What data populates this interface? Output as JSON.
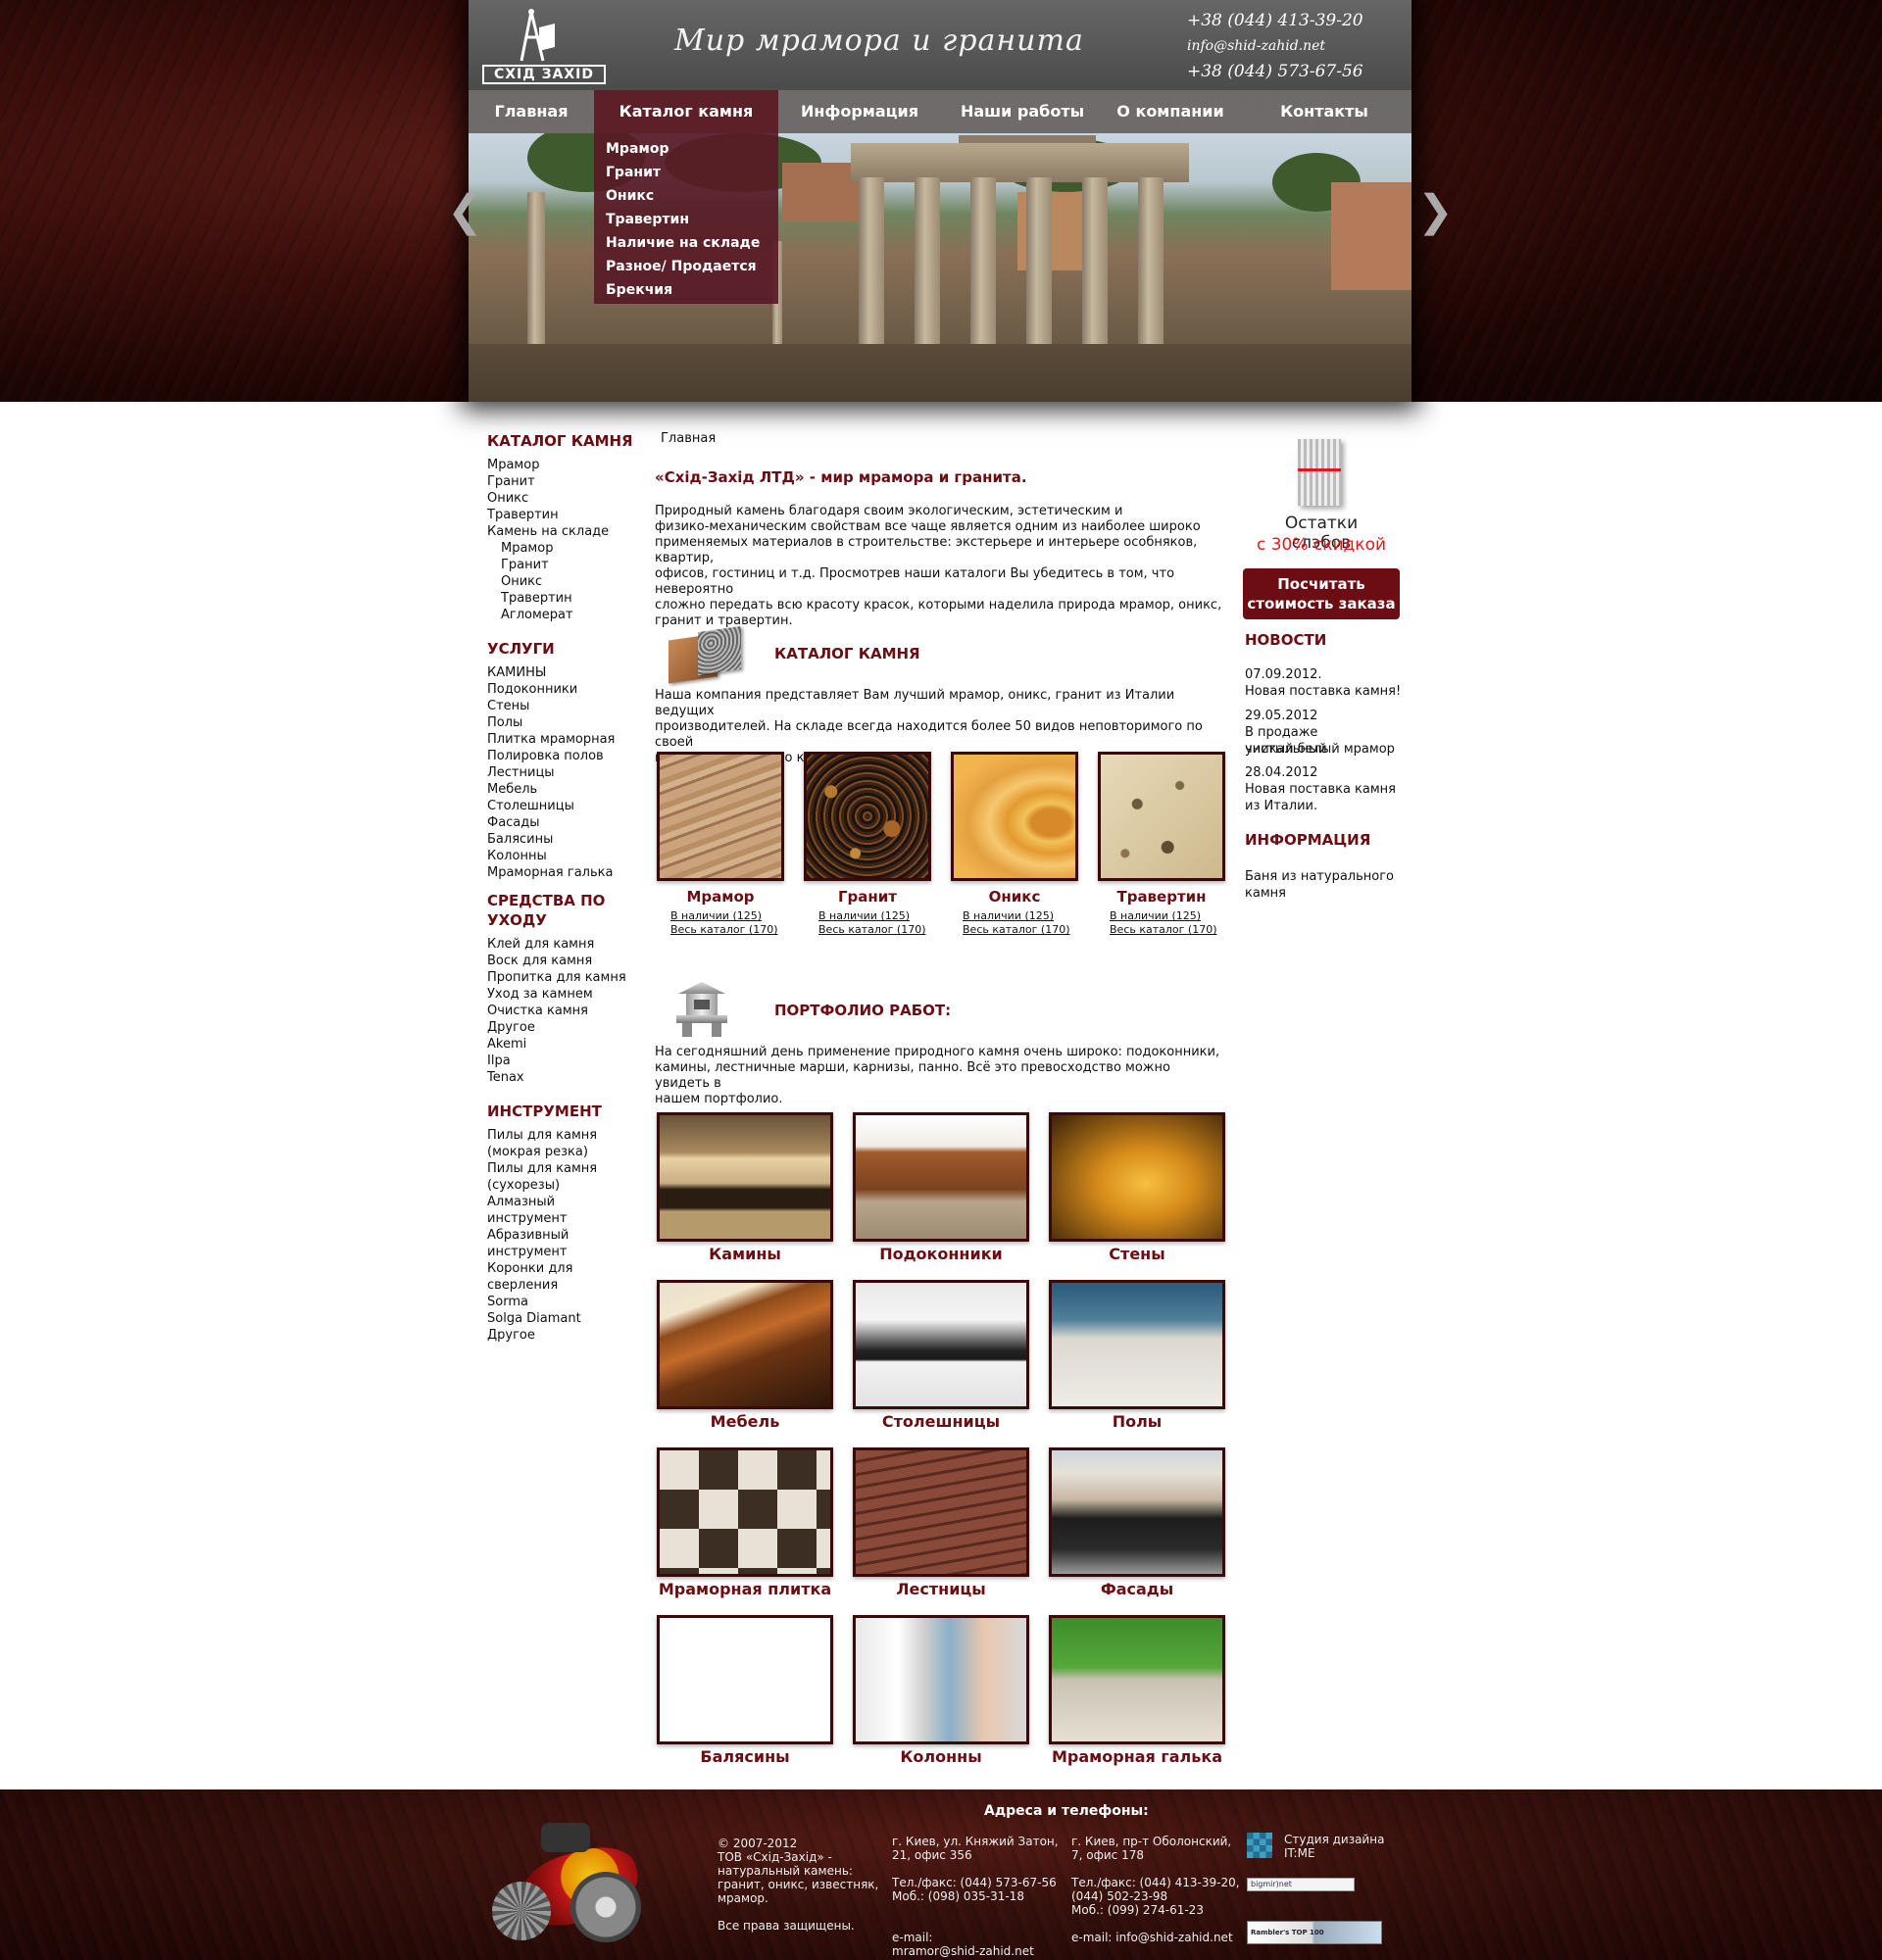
{
  "header": {
    "logo_text": "СХІД ЗАХІD",
    "slogan": "Мир мрамора и гранита",
    "phone1": "+38 (044) 413-39-20",
    "email": "info@shid-zahid.net",
    "phone2": "+38 (044) 573-67-56"
  },
  "nav": [
    {
      "label": "Главная"
    },
    {
      "label": "Каталог камня"
    },
    {
      "label": "Информация"
    },
    {
      "label": "Наши работы"
    },
    {
      "label": "О компании"
    },
    {
      "label": "Контакты"
    }
  ],
  "dropdown": [
    "Мрамор",
    "Гранит",
    "Оникс",
    "Травертин",
    "Наличие на складе",
    "Разное/ Продается",
    "Брекчия"
  ],
  "sidebar": {
    "catalog": {
      "title": "КАТАЛОГ КАМНЯ",
      "items": [
        "Мрамор",
        "Гранит",
        "Оникс",
        "Травертин",
        "Камень на складе"
      ],
      "subitems": [
        "Мрамор",
        "Гранит",
        "Оникс",
        "Травертин",
        "Агломерат"
      ]
    },
    "services": {
      "title": "УСЛУГИ",
      "items": [
        "КАМИНЫ",
        "Подоконники",
        "Стены",
        "Полы",
        "Плитка мраморная",
        "Полировка полов",
        "Лестницы",
        "Мебель",
        "Столешницы",
        "Фасады",
        "Балясины",
        "Колонны",
        "Мраморная галька"
      ]
    },
    "care": {
      "title_line1": "СРЕДСТВА ПО",
      "title_line2": "УХОДУ",
      "items": [
        "Клей для камня",
        "Воск для камня",
        "Пропитка для камня",
        "Уход за камнем",
        "Очистка камня",
        "Другое",
        "Akemi",
        "Ilpa",
        "Tenax"
      ]
    },
    "tools": {
      "title": "ИНСТРУМЕНТ",
      "items": [
        "Пилы для камня",
        "(мокрая резка)",
        "Пилы для камня",
        "(сухорезы)",
        "Алмазный инструмент",
        "Абразивный",
        "инструмент",
        "Коронки для",
        "сверления",
        "Sorma",
        "Solga Diamant",
        "Другое"
      ]
    }
  },
  "main": {
    "breadcrumb": "Главная",
    "title": "«Схід-Захід ЛТД» - мир мрамора и гранита.",
    "intro": [
      "Природный камень благодаря своим экологическим, эстетическим и",
      "физико-механическим свойствам все чаще является одним из наиболее широко",
      "применяемых материалов в строительстве: экстерьере и интерьере особняков, квартир,",
      "офисов, гостиниц и т.д. Просмотрев наши каталоги Вы убедитесь в том, что невероятно",
      "сложно передать всю красоту красок, которыми наделила природа мрамор, оникс,",
      "гранит и травертин."
    ],
    "catalog_heading": "КАТАЛОГ КАМНЯ",
    "catalog_text": [
      "Наша компания представляет Вам лучший мрамор, оникс, гранит из Италии ведущих",
      "производителей. На складе всегда находится более 50 видов неповторимого по своей",
      "красоте природного камня."
    ],
    "stones": [
      {
        "name": "Мрамор",
        "stock": "В наличии (125)",
        "all": "Весь каталог (170)"
      },
      {
        "name": "Гранит",
        "stock": "В наличии (125)",
        "all": "Весь каталог (170)"
      },
      {
        "name": "Оникс",
        "stock": "В наличии (125)",
        "all": "Весь каталог (170)"
      },
      {
        "name": "Травертин",
        "stock": "В наличии (125)",
        "all": "Весь каталог (170)"
      }
    ],
    "portfolio_heading": "ПОРТФОЛИО РАБОТ:",
    "portfolio_text": [
      "На сегодняшний день применение природного камня очень широко: подоконники,",
      "камины, лестничные марши, карнизы, панно. Всё это превосходство можно увидеть в",
      "нашем портфолио."
    ],
    "portfolio": [
      "Камины",
      "Подоконники",
      "Стены",
      "Мебель",
      "Столешницы",
      "Полы",
      "Мраморная плитка",
      "Лестницы",
      "Фасады",
      "Балясины",
      "Колонны",
      "Мраморная галька"
    ]
  },
  "right": {
    "promo_line1": "Остатки слэбов",
    "promo_line2": "с 30% скидкой",
    "calc_line1": "Посчитать",
    "calc_line2": "стоимость  заказа",
    "news_title": "НОВОСТИ",
    "news": [
      {
        "date": "07.09.2012.",
        "text": [
          "Новая поставка камня!"
        ]
      },
      {
        "date": "29.05.2012",
        "text": [
          "В продаже уникальный",
          "чистый белый мрамор"
        ]
      },
      {
        "date": "28.04.2012",
        "text": [
          "Новая поставка камня",
          "из Италии."
        ]
      }
    ],
    "info_title": "ИНФОРМАЦИЯ",
    "info_items": [
      "Баня из натурального",
      "камня"
    ]
  },
  "footer": {
    "heading": "Адреса  и телефоны:",
    "copyright": [
      "© 2007-2012",
      "ТОВ «Схід-Захід» -",
      "натуральный камень:",
      "гранит, оникс, известняк,",
      "мрамор.",
      "",
      "Все права защищены."
    ],
    "addr1": [
      "г. Киев, ул. Княжий Затон,",
      "21, офис 356",
      "",
      "Тел./факс: (044) 573-67-56",
      "Моб.: (098) 035-31-18",
      "",
      "",
      "e-mail:",
      "mramor@shid-zahid.net"
    ],
    "addr2": [
      "г. Киев, пр-т Оболонский,",
      "7, офис 178",
      "",
      "Тел./факс: (044) 413-39-20,",
      "(044) 502-23-98",
      "Моб.: (099) 274-61-23",
      "",
      "",
      "e-mail: info@shid-zahid.net"
    ],
    "studio": [
      "Студия дизайна",
      "IT:ME"
    ],
    "counter1": "bigmir)net",
    "counter2": "Rambler's TOP 100"
  }
}
